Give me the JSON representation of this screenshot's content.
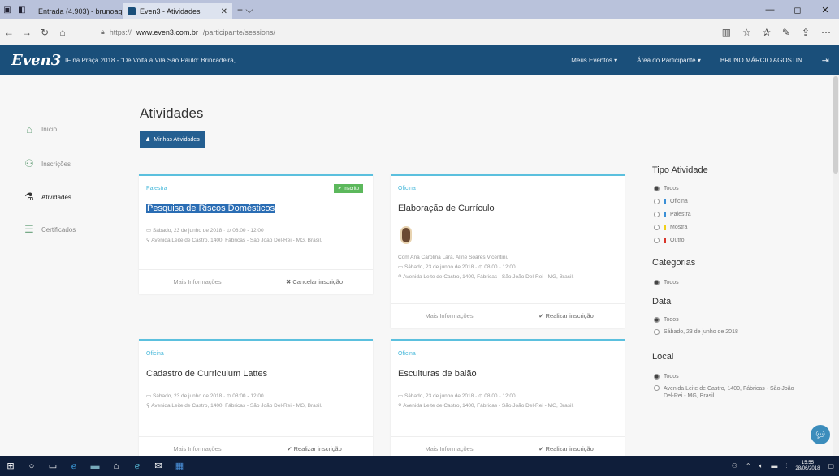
{
  "browser": {
    "tabs": [
      {
        "label": "Entrada (4.903) - brunoago",
        "favicon_color": "#d93025"
      },
      {
        "label": "Even3 - Atividades",
        "favicon_color": "#1a4f7a"
      }
    ],
    "url_prefix": "https://",
    "url_domain": "www.even3.com.br",
    "url_path": "/participante/sessions/"
  },
  "app": {
    "logo": "Even3",
    "event_title": "IF na Praça 2018 - \"De Volta à Vila São Paulo: Brincadeira,...",
    "nav": {
      "meus_eventos": "Meus Eventos ▾",
      "area_participante": "Área do Participante ▾",
      "user": "BRUNO MÁRCIO AGOSTIN"
    }
  },
  "sidebar": {
    "items": [
      {
        "label": "Início",
        "icon": "home-icon"
      },
      {
        "label": "Inscrições",
        "icon": "user-plus-icon"
      },
      {
        "label": "Atividades",
        "icon": "flask-icon"
      },
      {
        "label": "Certificados",
        "icon": "certificate-icon"
      }
    ]
  },
  "main": {
    "title": "Atividades",
    "minhas_button": "Minhas Atividades",
    "cards": [
      {
        "type": "Palestra",
        "title": "Pesquisa de Riscos Domésticos",
        "badge": "✔ Inscrito",
        "date": "Sábado, 23 de junho de 2018 · ⊙ 08:00 - 12:00",
        "address": "Avenida Leite de Castro, 1400, Fábricas - São João Del-Rei - MG, Brasil.",
        "more": "Mais Informações",
        "action": "✖ Cancelar inscrição"
      },
      {
        "type": "Oficina",
        "title": "Elaboração de Currículo",
        "presenters": "Com Ana Carolina Lara, Aline Soares Vicentini,",
        "date": "Sábado, 23 de junho de 2018 · ⊙ 08:00 - 12:00",
        "address": "Avenida Leite de Castro, 1400, Fábricas - São João Del-Rei - MG, Brasil.",
        "more": "Mais Informações",
        "action": "✔ Realizar inscrição"
      },
      {
        "type": "Oficina",
        "title": "Cadastro de Curriculum Lattes",
        "date": "Sábado, 23 de junho de 2018 · ⊙ 08:00 - 12:00",
        "address": "Avenida Leite de Castro, 1400, Fábricas - São João Del-Rei - MG, Brasil.",
        "more": "Mais Informações",
        "action": "✔ Realizar inscrição"
      },
      {
        "type": "Oficina",
        "title": "Esculturas de balão",
        "date": "Sábado, 23 de junho de 2018 · ⊙ 08:00 - 12:00",
        "address": "Avenida Leite de Castro, 1400, Fábricas - São João Del-Rei - MG, Brasil.",
        "more": "Mais Informações",
        "action": "✔ Realizar inscrição"
      }
    ]
  },
  "filters": {
    "tipo_title": "Tipo Atividade",
    "tipo_options": [
      {
        "label": "Todos",
        "checked": true,
        "color": ""
      },
      {
        "label": "Oficina",
        "checked": false,
        "color": "#3a8fd6"
      },
      {
        "label": "Palestra",
        "checked": false,
        "color": "#3a8fd6"
      },
      {
        "label": "Mostra",
        "checked": false,
        "color": "#f0d01a"
      },
      {
        "label": "Outro",
        "checked": false,
        "color": "#d9352a"
      }
    ],
    "categorias_title": "Categorias",
    "categorias_options": [
      {
        "label": "Todos",
        "checked": true
      }
    ],
    "data_title": "Data",
    "data_options": [
      {
        "label": "Todos",
        "checked": true
      },
      {
        "label": "Sábado, 23 de junho de 2018",
        "checked": false
      }
    ],
    "local_title": "Local",
    "local_options": [
      {
        "label": "Todos",
        "checked": true
      },
      {
        "label": "Avenida Leite de Castro, 1400, Fábricas - São João Del-Rei - MG, Brasil.",
        "checked": false
      }
    ]
  },
  "taskbar": {
    "time": "15:55",
    "date": "28/06/2018"
  }
}
